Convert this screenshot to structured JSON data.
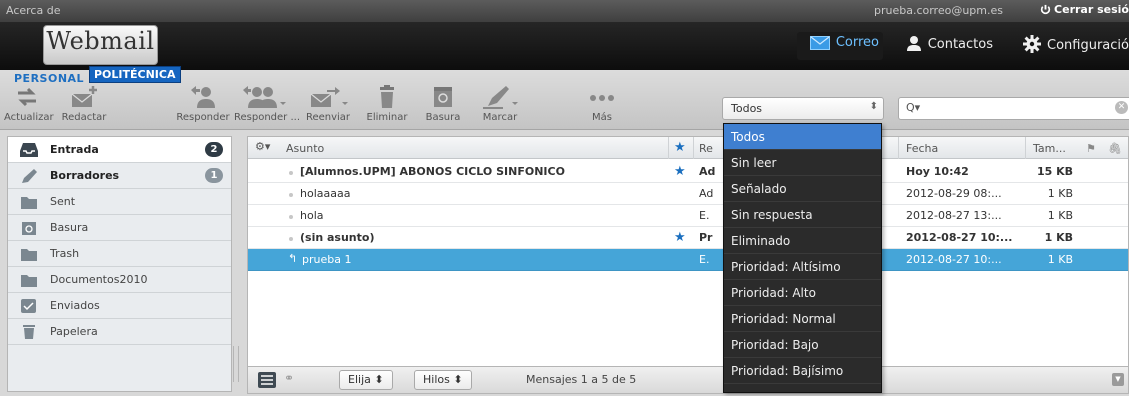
{
  "topbar": {
    "about": "Acerca de",
    "email": "prueba.correo@upm.es",
    "logout": "Cerrar sesió"
  },
  "header": {
    "logo": "Webmail",
    "badge_personal": "PERSONAL",
    "badge_politecnica": "POLITÉCNICA",
    "nav": {
      "correo": "Correo",
      "contactos": "Contactos",
      "configuracion": "Configuració"
    }
  },
  "toolbar": {
    "actualizar": "Actualizar",
    "redactar": "Redactar",
    "responder": "Responder",
    "responder_todos": "Responder ...",
    "reenviar": "Reenviar",
    "eliminar": "Eliminar",
    "basura": "Basura",
    "marcar": "Marcar",
    "mas": "Más",
    "filter": "Todos",
    "search_placeholder": "Q▾"
  },
  "sidebar": {
    "folders": [
      {
        "label": "Entrada",
        "count": "2",
        "icon": "inbox-icon"
      },
      {
        "label": "Borradores",
        "count": "1",
        "icon": "pencil-icon"
      },
      {
        "label": "Sent",
        "icon": "folder-icon"
      },
      {
        "label": "Basura",
        "icon": "junk-icon"
      },
      {
        "label": "Trash",
        "icon": "folder-icon"
      },
      {
        "label": "Documentos2010",
        "icon": "folder-icon"
      },
      {
        "label": "Enviados",
        "icon": "sent-icon"
      },
      {
        "label": "Papelera",
        "icon": "trash-icon"
      }
    ]
  },
  "list": {
    "columns": {
      "subject": "Asunto",
      "from": "Re",
      "date": "Fecha",
      "size": "Tam..."
    },
    "rows": [
      {
        "subject": "[Alumnos.UPM] ABONOS CICLO SINFONICO",
        "from": "Ad",
        "date": "Hoy 10:42",
        "size": "15 KB",
        "flagged": true,
        "unread": true
      },
      {
        "subject": "holaaaaa",
        "from": "Ad",
        "date": "2012-08-29 08:...",
        "size": "1 KB",
        "flagged": false,
        "unread": false
      },
      {
        "subject": "hola",
        "from": "E.",
        "date": "2012-08-27 13:...",
        "size": "1 KB",
        "flagged": false,
        "unread": false
      },
      {
        "subject": "(sin asunto)",
        "from": "Pr",
        "date": "2012-08-27 10:...",
        "size": "1 KB",
        "flagged": true,
        "unread": true
      },
      {
        "subject": "prueba 1",
        "from": "E.",
        "date": "2012-08-27 10:...",
        "size": "1 KB",
        "flagged": false,
        "unread": false,
        "selected": true
      }
    ],
    "footer": {
      "select": "Elija",
      "threads": "Hilos",
      "paging": "Mensajes 1 a 5 de 5"
    }
  },
  "filter_dropdown": {
    "options": [
      "Todos",
      "Sin leer",
      "Señalado",
      "Sin respuesta",
      "Eliminado",
      "Prioridad: Altísimo",
      "Prioridad: Alto",
      "Prioridad: Normal",
      "Prioridad: Bajo",
      "Prioridad: Bajísimo"
    ],
    "selected": "Todos"
  },
  "colors": {
    "accent": "#45a5d8",
    "dropdown_active": "#3f7fd0",
    "star": "#1b6fbf"
  }
}
